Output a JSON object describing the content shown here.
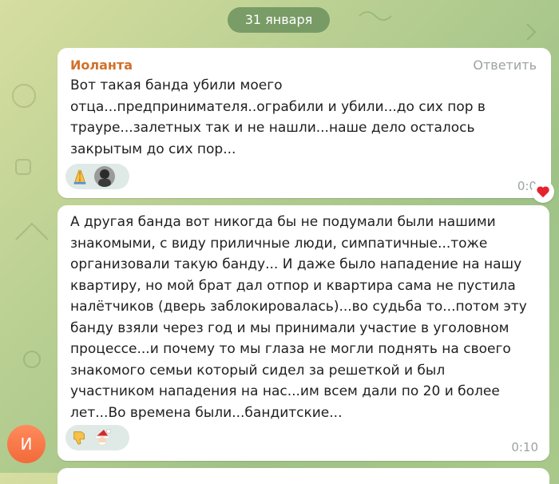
{
  "date_separator": "31 января",
  "messages": [
    {
      "sender": "Иоланта",
      "reply_label": "Ответить",
      "text": "Вот такая банда убили моего\nотца...предпринимателя..ограбили и убили...до сих пор в\nтрауре...залетных так и не нашли...наше дело осталось\nзакрытым до сих пор...",
      "time": "0:0",
      "reactions": [
        "folded-hands-emoji",
        "user-avatar"
      ],
      "heart_reaction_icon": "heart-icon"
    },
    {
      "text": "А другая банда вот никогда бы не подумали были нашими\nзнакомыми, с виду приличные люди, симпатичные...тоже\nорганизовали такую банду... И даже было нападение на нашу\nквартиру, но мой брат дал отпор и квартира сама не пустила\nналётчиков (дверь заблокировалась)...во судьба то...потом эту\nбанду взяли через год и мы принимали участие в уголовном\nпроцессе...и почему то мы глаза не могли поднять на своего\nзнакомого семьи который сидел за решеткой и был\nучастником нападения на нас...им всем дали по 20 и более\nлет...Во времена были...бандитские...",
      "time": "0:10",
      "reactions": [
        "thumbs-down-emoji",
        "santa-emoji"
      ]
    }
  ],
  "sender_avatar_initial": "И",
  "colors": {
    "sender_name": "#d2702a",
    "avatar": "#f26a3a",
    "background": "#b9cf92"
  }
}
